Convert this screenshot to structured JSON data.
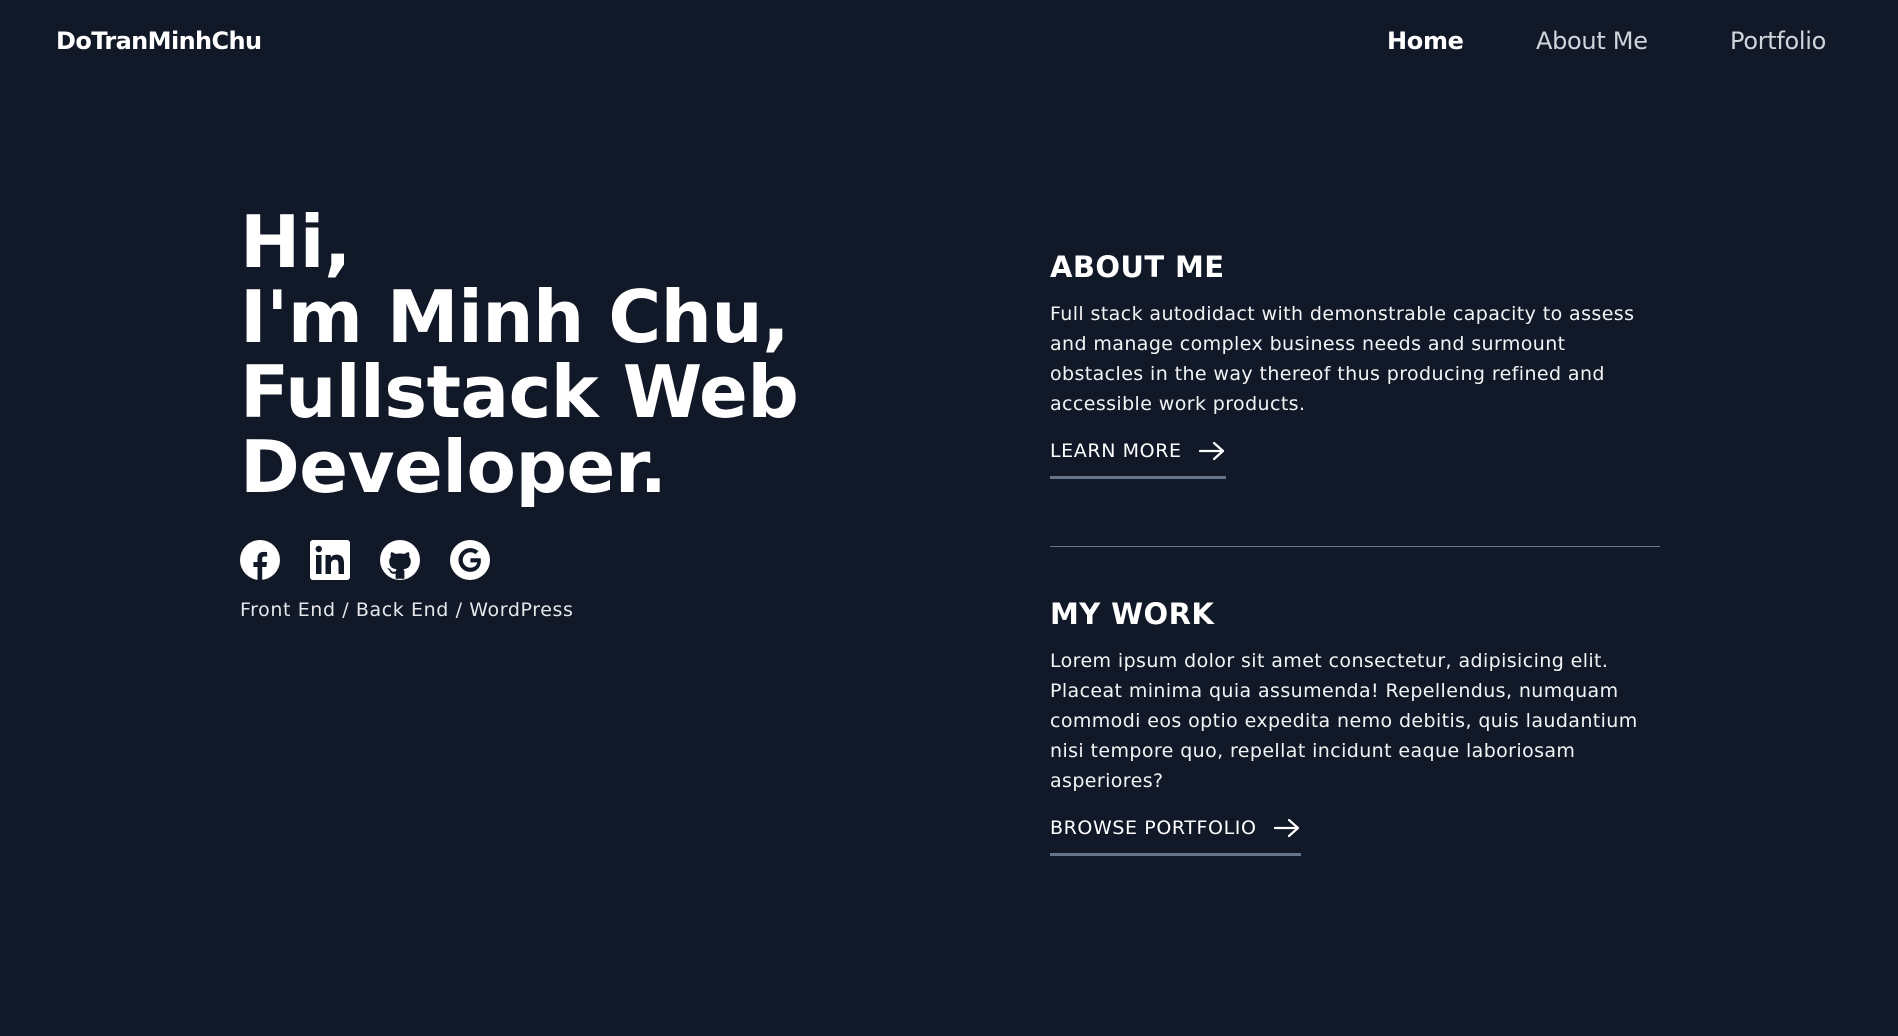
{
  "colors": {
    "background": "#111827",
    "text": "#ffffff",
    "muted_text": "#d1d5db",
    "underline": "#64748b"
  },
  "nav": {
    "brand": "DoTranMinhChu",
    "links": [
      {
        "label": "Home",
        "active": true
      },
      {
        "label": "About Me",
        "active": false
      },
      {
        "label": "Portfolio",
        "active": false
      }
    ]
  },
  "hero": {
    "title_lines": [
      "Hi,",
      "I'm Minh Chu,",
      "Fullstack Web",
      "Developer."
    ],
    "socials": [
      {
        "icon": "facebook-icon"
      },
      {
        "icon": "linkedin-icon"
      },
      {
        "icon": "github-icon"
      },
      {
        "icon": "google-icon"
      }
    ],
    "tagline": "Front End / Back End / WordPress"
  },
  "about": {
    "heading": "ABOUT ME",
    "text": "Full stack autodidact with demonstrable capacity to assess and manage complex business needs and surmount obstacles in the way thereof thus producing refined and accessible work products.",
    "cta": "LEARN MORE",
    "cta_icon": "arrow-right-icon"
  },
  "work": {
    "heading": "MY WORK",
    "text": "Lorem ipsum dolor sit amet consectetur, adipisicing elit. Placeat minima quia assumenda! Repellendus, numquam commodi eos optio expedita nemo debitis, quis laudantium nisi tempore quo, repellat incidunt eaque laboriosam asperiores?",
    "cta": "BROWSE PORTFOLIO",
    "cta_icon": "arrow-right-icon"
  }
}
